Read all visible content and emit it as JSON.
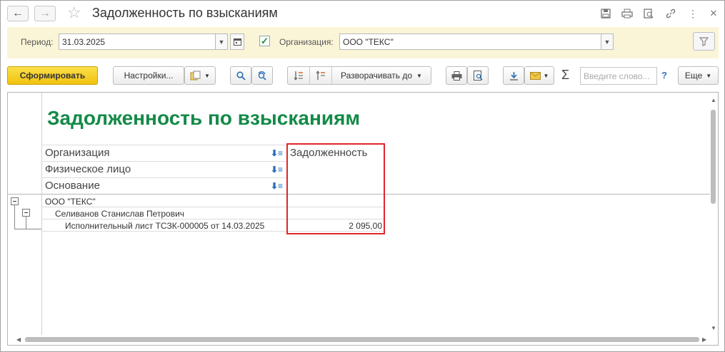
{
  "window": {
    "title": "Задолженность по взысканиям"
  },
  "filter": {
    "period_label": "Период:",
    "period_value": "31.03.2025",
    "org_label": "Организация:",
    "org_value": "ООО \"ТЕКС\"",
    "org_checked": true
  },
  "toolbar": {
    "generate_label": "Сформировать",
    "settings_label": "Настройки...",
    "expand_label": "Разворачивать до",
    "search_placeholder": "Введите слово...",
    "help_label": "?",
    "more_label": "Еще"
  },
  "report": {
    "title": "Задолженность по взысканиям",
    "group_headers": [
      "Организация",
      "Физическое лицо",
      "Основание"
    ],
    "value_header": "Задолженность",
    "rows": [
      {
        "level": 1,
        "label": "ООО \"ТЕКС\"",
        "value": ""
      },
      {
        "level": 2,
        "label": "Селиванов Станислав Петрович",
        "value": ""
      },
      {
        "level": 3,
        "label": "Исполнительный лист ТСЗК-000005 от 14.03.2025",
        "value": "2 095,00"
      }
    ]
  },
  "colors": {
    "title_green": "#138a47",
    "filter_bg": "#fbf5d8",
    "primary_button": "#f1c20e",
    "highlight_red": "#e0262c"
  }
}
